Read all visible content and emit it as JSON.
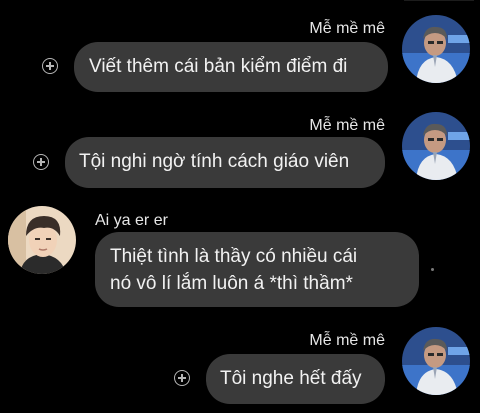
{
  "messages": [
    {
      "sender": "Mễ mề mê",
      "text": "Viết thêm cái bản kiểm điểm đi",
      "side": "right"
    },
    {
      "sender": "Mễ mề mê",
      "text": "Tội nghi ngờ tính cách giáo viên",
      "side": "right"
    },
    {
      "sender": "Ai ya er er",
      "text_lines": [
        "Thiệt tình là thầy có nhiều cái",
        "nó vô lí lắm luôn á *thì thầm*"
      ],
      "side": "left"
    },
    {
      "sender": "Mễ mề mê",
      "text": "Tôi nghe hết đấy",
      "side": "right"
    }
  ],
  "icons": {
    "react": "add-reaction-icon",
    "avatar_right": "user-avatar",
    "avatar_left": "user-avatar"
  },
  "colors": {
    "background": "#000000",
    "bubble": "#3a3a3a",
    "text": "#f2f2f2"
  }
}
